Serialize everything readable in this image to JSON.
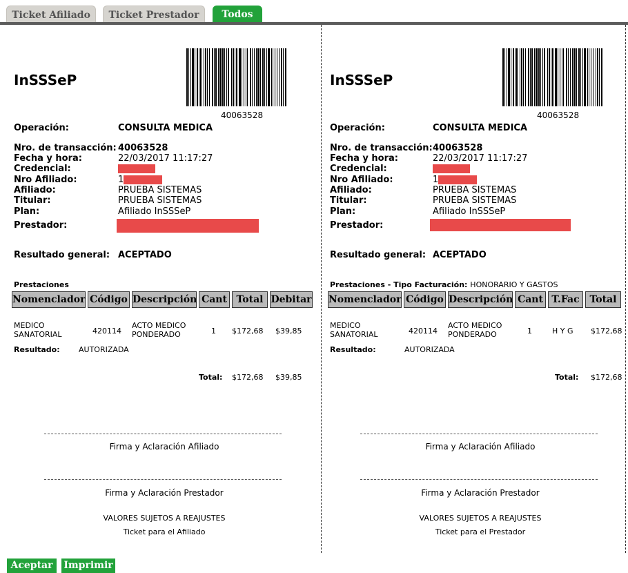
{
  "tabs": [
    {
      "label": "Ticket Afiliado"
    },
    {
      "label": "Ticket Prestador"
    },
    {
      "label": "Todos"
    }
  ],
  "common": {
    "logo": "InSSSeP",
    "barcode_number": "40063528",
    "labels": {
      "operacion": "Operación:",
      "nro_transaccion": "Nro. de transacción:",
      "fecha_hora": "Fecha y hora:",
      "credencial": "Credencial:",
      "nro_afiliado": "Nro Afiliado:",
      "afiliado": "Afiliado:",
      "titular": "Titular:",
      "plan": "Plan:",
      "prestador": "Prestador:",
      "resultado_general": "Resultado general:",
      "resultado": "Resultado:",
      "total": "Total:"
    },
    "values": {
      "operacion": "CONSULTA MEDICA",
      "nro_transaccion": "40063528",
      "fecha_hora": "22/03/2017 11:17:27",
      "nro_afiliado_prefix": "1",
      "afiliado": "PRUEBA SISTEMAS",
      "titular": "PRUEBA SISTEMAS",
      "plan": "Afiliado InSSSeP",
      "resultado_general": "ACEPTADO"
    },
    "item": {
      "nomenclador": [
        "MEDICO",
        "SANATORIAL"
      ],
      "codigo": "420114",
      "descripcion": [
        "ACTO MEDICO",
        "PONDERADO"
      ],
      "cant": "1",
      "total": "$172,68",
      "resultado": "AUTORIZADA"
    },
    "firma_afiliado": "Firma y Aclaración Afiliado",
    "firma_prestador": "Firma y Aclaración Prestador",
    "valores": "VALORES SUJETOS A REAJUSTES"
  },
  "left": {
    "section_title": "Prestaciones",
    "headers": [
      "Nomenclador",
      "Código",
      "Descripción",
      "Cant",
      "Total",
      "Debitar"
    ],
    "debitar": "$39,85",
    "total_sum": "$172,68",
    "total_debitar": "$39,85",
    "footer": "Ticket para el Afiliado"
  },
  "right": {
    "section_title": "Prestaciones - Tipo Facturación:",
    "section_extra": "HONORARIO Y GASTOS",
    "headers": [
      "Nomenclador",
      "Código",
      "Descripción",
      "Cant",
      "T.Fac",
      "Total"
    ],
    "tfac": "H Y G",
    "total_sum": "$172,68",
    "footer": "Ticket para el Prestador"
  },
  "buttons": {
    "aceptar": "Aceptar",
    "imprimir": "Imprimir"
  },
  "colors": {
    "accent_green": "#22a23a",
    "redaction": "#e84a4a",
    "header_gray": "#b9b9b9"
  }
}
